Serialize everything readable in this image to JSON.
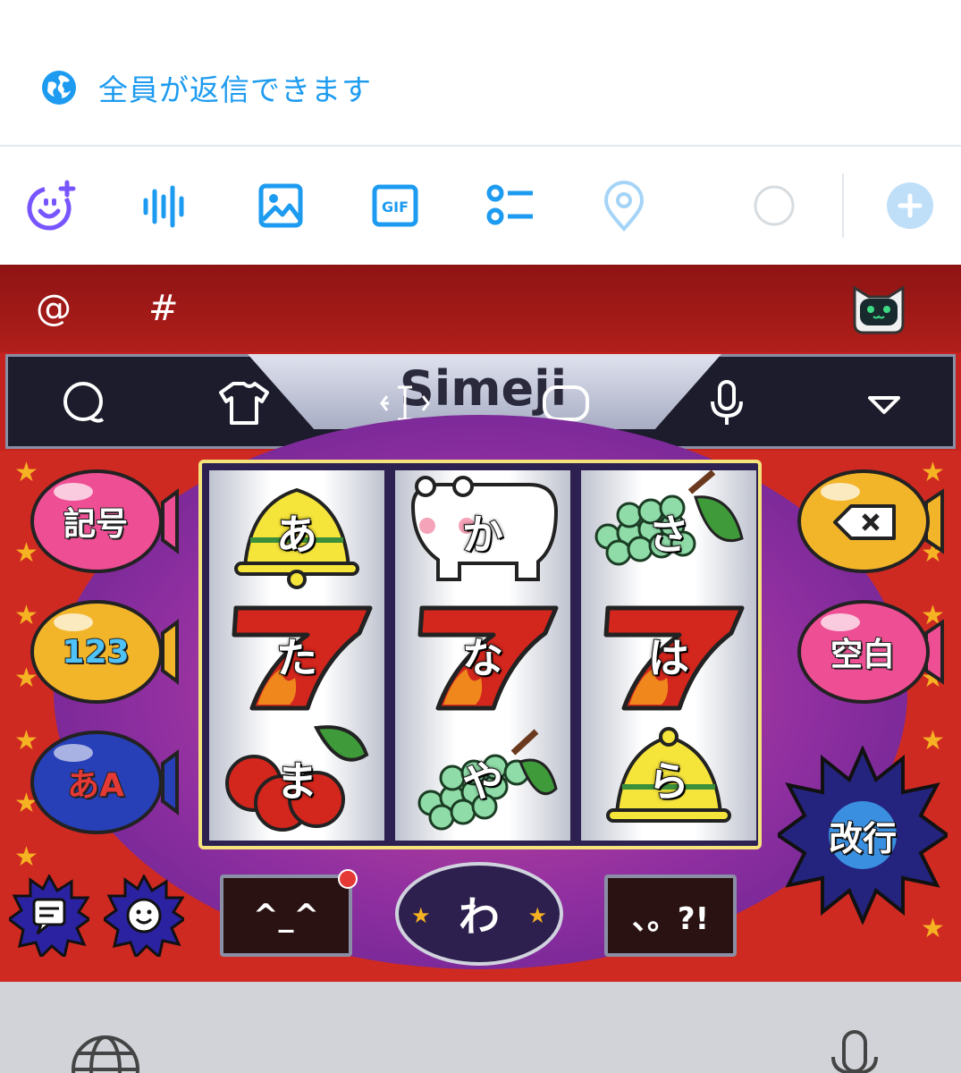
{
  "reply_setting": {
    "label": "全員が返信できます",
    "icon": "globe-icon"
  },
  "toolbar": {
    "items": [
      "grok-icon",
      "voice-icon",
      "image-icon",
      "gif-icon",
      "poll-icon",
      "location-icon",
      "char-counter",
      "add-thread-icon"
    ],
    "gif_label": "GIF"
  },
  "keyboard": {
    "candidates": {
      "at": "@",
      "hash": "#"
    },
    "brand": "Simeji",
    "reels": [
      [
        "あ",
        "た",
        "ま"
      ],
      [
        "か",
        "な",
        "や"
      ],
      [
        "さ",
        "は",
        "ら"
      ]
    ],
    "left_buttons": {
      "symbols": "記号",
      "numbers": "123",
      "mode": "あA"
    },
    "right_buttons": {
      "space": "空白",
      "enter": "改行"
    },
    "bottom": {
      "emoticon": "^_^",
      "wa": "わ",
      "punct": "、。?!"
    }
  },
  "colors": {
    "twitter_blue": "#1d9bf0",
    "keyboard_red": "#c4231f",
    "reel_frame": "#f4e27a"
  }
}
